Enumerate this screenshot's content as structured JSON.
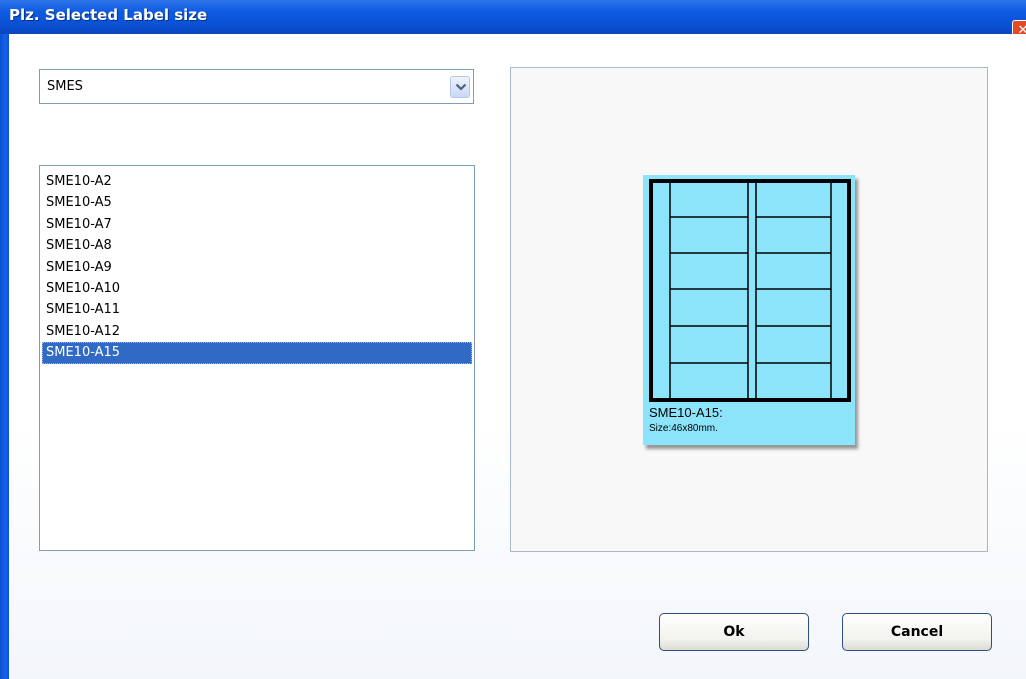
{
  "window": {
    "title": "Plz. Selected Label size",
    "close_glyph": "✕"
  },
  "category_select": {
    "value": "SMES",
    "arrow_icon": "chevron-down-icon"
  },
  "label_list": {
    "items": [
      "SME10-A2",
      "SME10-A5",
      "SME10-A7",
      "SME10-A8",
      "SME10-A9",
      "SME10-A10",
      "SME10-A11",
      "SME10-A12",
      "SME10-A15"
    ],
    "selected_index": 8
  },
  "preview": {
    "name": "SME10-A15:",
    "size_text": "Size:46x80mm.",
    "card_color": "#8be4fa"
  },
  "buttons": {
    "ok_label": "Ok",
    "cancel_label": "Cancel"
  },
  "colors": {
    "titlebar": "#0a52d6",
    "selection": "#316ac5"
  }
}
